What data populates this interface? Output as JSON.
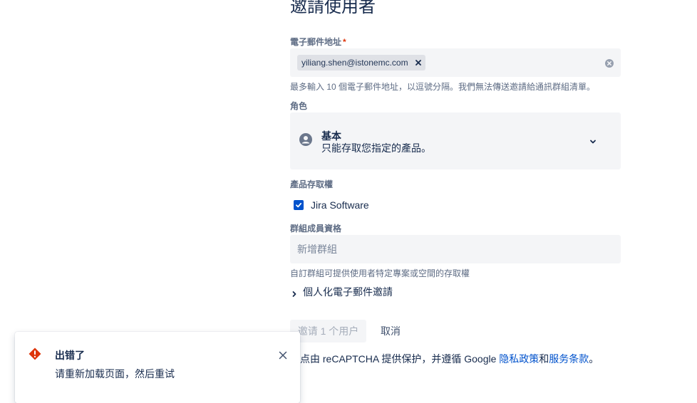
{
  "dialog": {
    "title": "邀請使用者"
  },
  "email": {
    "label": "電子郵件地址",
    "required_mark": "*",
    "tags": [
      "yiliang.shen@istonemc.com"
    ],
    "helper": "最多輸入 10 個電子郵件地址，以逗號分隔。我們無法傳送邀請給通訊群組清單。"
  },
  "role": {
    "label": "角色",
    "selected_name": "基本",
    "selected_description": "只能存取您指定的產品。"
  },
  "product_access": {
    "label": "產品存取權",
    "products": [
      {
        "name": "Jira Software",
        "checked": true
      }
    ]
  },
  "group": {
    "label": "群組成員資格",
    "placeholder": "新增群組",
    "helper": "自訂群組可提供使用者特定專案或空間的存取權"
  },
  "personalize": {
    "label": "個人化電子郵件邀請"
  },
  "actions": {
    "invite_label": "邀请 1 个用户",
    "cancel_label": "取消"
  },
  "recaptcha": {
    "prefix": "站点由 reCAPTCHA 提供保护，并遵循 Google ",
    "privacy_link": "隐私政策",
    "and": "和",
    "terms_link": "服务条款",
    "suffix": "。"
  },
  "error_flag": {
    "title": "出错了",
    "message": "请重新加载页面，然后重试"
  },
  "colors": {
    "primary": "#0052cc",
    "error": "#de350b",
    "field_bg": "#f4f5f7",
    "text": "#172b4d",
    "subtle_text": "#5e6c84"
  }
}
